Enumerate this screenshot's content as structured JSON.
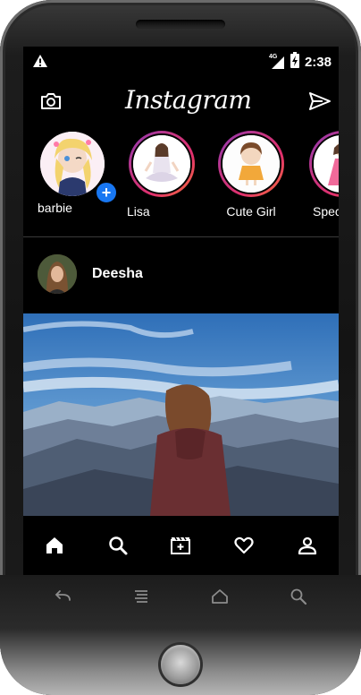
{
  "status_bar": {
    "time": "2:38",
    "network": "4G",
    "warning_icon": "warning-icon",
    "battery_icon": "battery-charging-icon"
  },
  "app_bar": {
    "logo": "Instagram",
    "left_icon": "camera-icon",
    "right_icon": "send-icon"
  },
  "stories": [
    {
      "label": "barbie",
      "own": true,
      "badge": "+"
    },
    {
      "label": "Lisa"
    },
    {
      "label": "Cute Girl"
    },
    {
      "label": "Specx"
    }
  ],
  "post": {
    "username": "Deesha"
  },
  "bottom_nav": {
    "tabs": [
      "home-icon",
      "search-icon",
      "reels-icon",
      "heart-icon",
      "profile-icon"
    ],
    "active": "home-icon"
  },
  "device_keys": [
    "back-icon",
    "menu-icon",
    "home-outline-icon",
    "search-icon"
  ],
  "colors": {
    "background": "#000000",
    "accent_blue": "#1877f2",
    "story_ring_start": "#8a3ab9",
    "story_ring_end": "#f77737"
  }
}
